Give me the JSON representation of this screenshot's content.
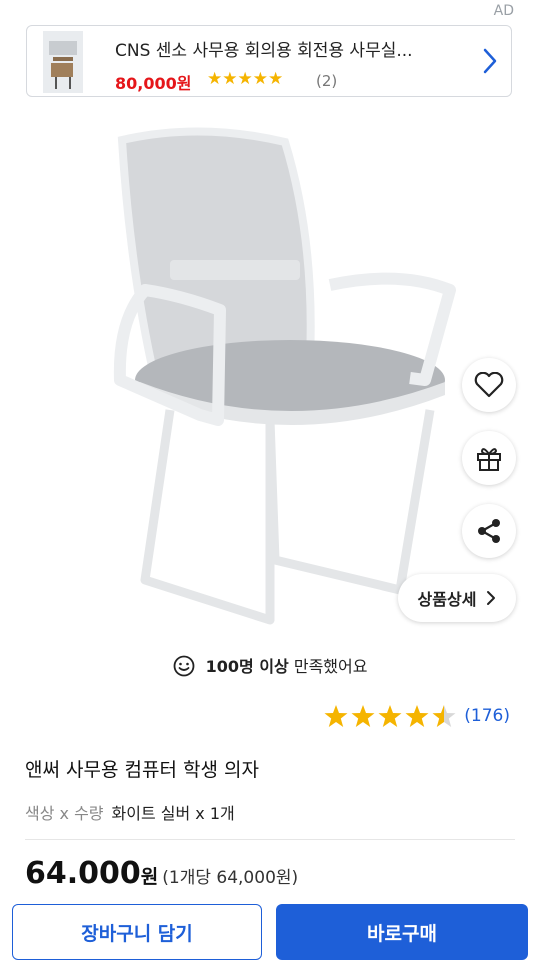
{
  "ad": {
    "label": "AD",
    "title": "CNS 센소 사무용 회의용 회전용 사무실...",
    "price": "80,000원",
    "stars": "★★★★★",
    "review_count": "(2)"
  },
  "detail_button": "상품상세",
  "satisfaction": {
    "count": "100명 이상",
    "text": " 만족했어요"
  },
  "rating": {
    "value": 4.5,
    "count": "(176)"
  },
  "product": {
    "name": "앤써 사무용 컴퓨터 학생 의자",
    "option_label": "색상 x 수량",
    "option_value": "화이트 실버 x 1개",
    "price": "64.000",
    "currency": "원",
    "unit_price": "(1개당 64,000원)"
  },
  "actions": {
    "cart": "장바구니 담기",
    "buy": "바로구매"
  },
  "colors": {
    "accent": "#1e5fd8",
    "price_red": "#e5161a",
    "star": "#f5b400"
  }
}
